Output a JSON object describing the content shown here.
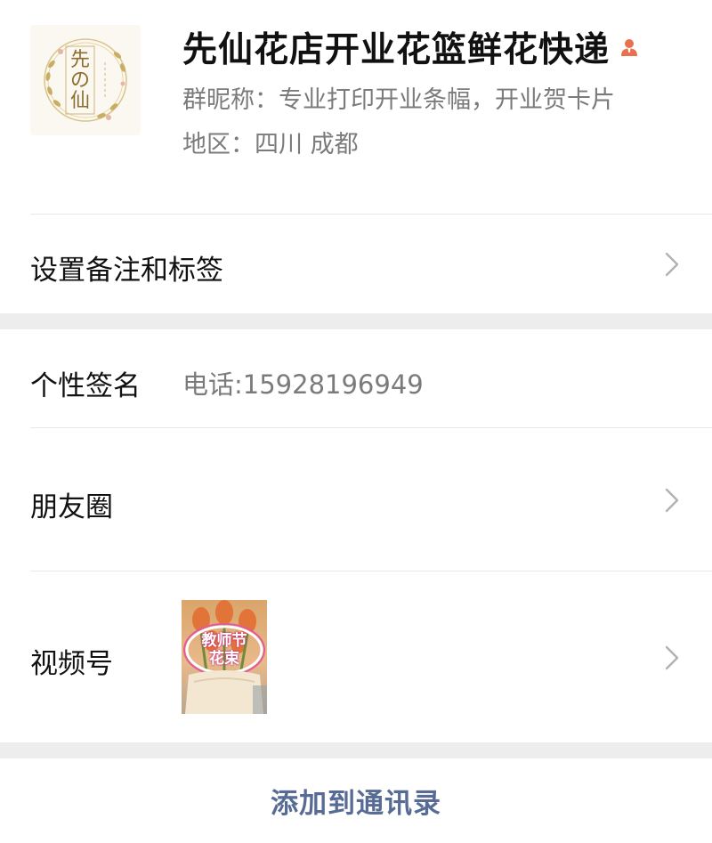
{
  "profile": {
    "avatar_icon": "flower-wreath-logo",
    "avatar_text": "先の仙",
    "name": "先仙花店开业花篮鲜花快递",
    "work_badge_icon": "work-account-icon",
    "nickname": "群昵称：专业打印开业条幅，开业贺卡片",
    "region": "地区：四川  成都"
  },
  "rows": {
    "remark_label": "设置备注和标签",
    "signature_label": "个性签名",
    "signature_value": "电话:15928196949",
    "moments_label": "朋友圈",
    "channels_label": "视频号",
    "channels_thumb_line1": "教师节",
    "channels_thumb_line2": "花束"
  },
  "actions": {
    "add_contact": "添加到通讯录"
  },
  "colors": {
    "link": "#576b95",
    "secondary_text": "#7b7b7b",
    "separator_band": "#ededed",
    "work_badge": "#e8704f"
  }
}
